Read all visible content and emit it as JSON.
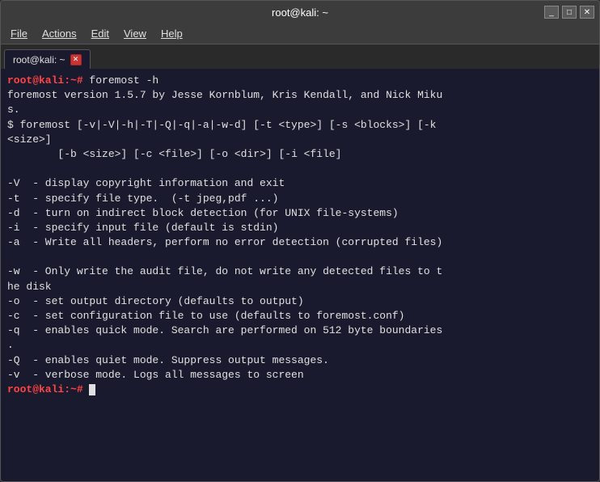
{
  "window": {
    "title": "root@kali: ~",
    "controls": {
      "minimize": "_",
      "maximize": "□",
      "close": "✕"
    }
  },
  "menubar": {
    "items": [
      {
        "label": "File",
        "underline_index": 0
      },
      {
        "label": "Actions",
        "underline_index": 0
      },
      {
        "label": "Edit",
        "underline_index": 0
      },
      {
        "label": "View",
        "underline_index": 0
      },
      {
        "label": "Help",
        "underline_index": 0
      }
    ]
  },
  "tab": {
    "label": "root@kali: ~"
  },
  "terminal": {
    "prompt_color": "#ff4444",
    "lines": [
      {
        "type": "prompt_cmd",
        "prompt": "root@kali:~# ",
        "cmd": "foremost -h"
      },
      {
        "type": "output",
        "text": "foremost version 1.5.7 by Jesse Kornblum, Kris Kendall, and Nick Miku"
      },
      {
        "type": "output",
        "text": "s."
      },
      {
        "type": "output",
        "text": "$ foremost [-v|-V|-h|-T|-Q|-q|-a|-w-d] [-t <type>] [-s <blocks>] [-k"
      },
      {
        "type": "output",
        "text": "<size>]"
      },
      {
        "type": "output",
        "text": "        [-b <size>] [-c <file>] [-o <dir>] [-i <file]"
      },
      {
        "type": "empty"
      },
      {
        "type": "output",
        "text": "-V  - display copyright information and exit"
      },
      {
        "type": "output",
        "text": "-t  - specify file type.  (-t jpeg,pdf ...)"
      },
      {
        "type": "output",
        "text": "-d  - turn on indirect block detection (for UNIX file-systems)"
      },
      {
        "type": "output",
        "text": "-i  - specify input file (default is stdin)"
      },
      {
        "type": "output",
        "text": "-a  - Write all headers, perform no error detection (corrupted files)"
      },
      {
        "type": "empty"
      },
      {
        "type": "output",
        "text": "-w  - Only write the audit file, do not write any detected files to t"
      },
      {
        "type": "output",
        "text": "he disk"
      },
      {
        "type": "output",
        "text": "-o  - set output directory (defaults to output)"
      },
      {
        "type": "output",
        "text": "-c  - set configuration file to use (defaults to foremost.conf)"
      },
      {
        "type": "output",
        "text": "-q  - enables quick mode. Search are performed on 512 byte boundaries"
      },
      {
        "type": "output",
        "text": "."
      },
      {
        "type": "output",
        "text": "-Q  - enables quiet mode. Suppress output messages."
      },
      {
        "type": "output",
        "text": "-v  - verbose mode. Logs all messages to screen"
      },
      {
        "type": "prompt_cursor",
        "prompt": "root@kali:~# "
      }
    ]
  }
}
